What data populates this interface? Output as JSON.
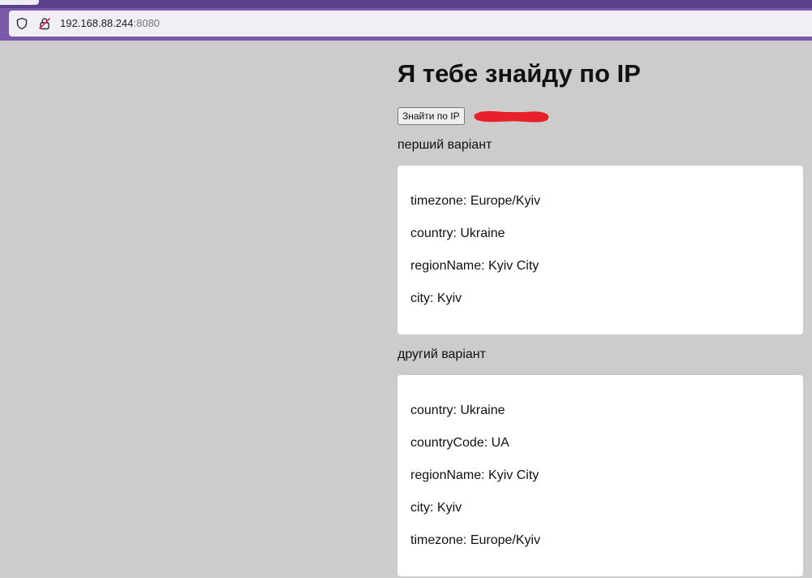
{
  "browser": {
    "url_host": "192.168.88.244",
    "url_port": ":8080"
  },
  "page": {
    "title": "Я тебе знайду по IP",
    "find_button_label": "Знайти по IP"
  },
  "first": {
    "label": "перший варіант",
    "lines": [
      "timezone: Europe/Kyiv",
      "country: Ukraine",
      "regionName: Kyiv City",
      "city: Kyiv"
    ]
  },
  "second": {
    "label": "другий варіант",
    "lines": [
      "country: Ukraine",
      "countryCode: UA",
      "regionName: Kyiv City",
      "city: Kyiv",
      "timezone: Europe/Kyiv"
    ]
  },
  "colors": {
    "browser_chrome": "#7a5aa8",
    "background": "#cccccc",
    "redaction": "#e8202a"
  }
}
